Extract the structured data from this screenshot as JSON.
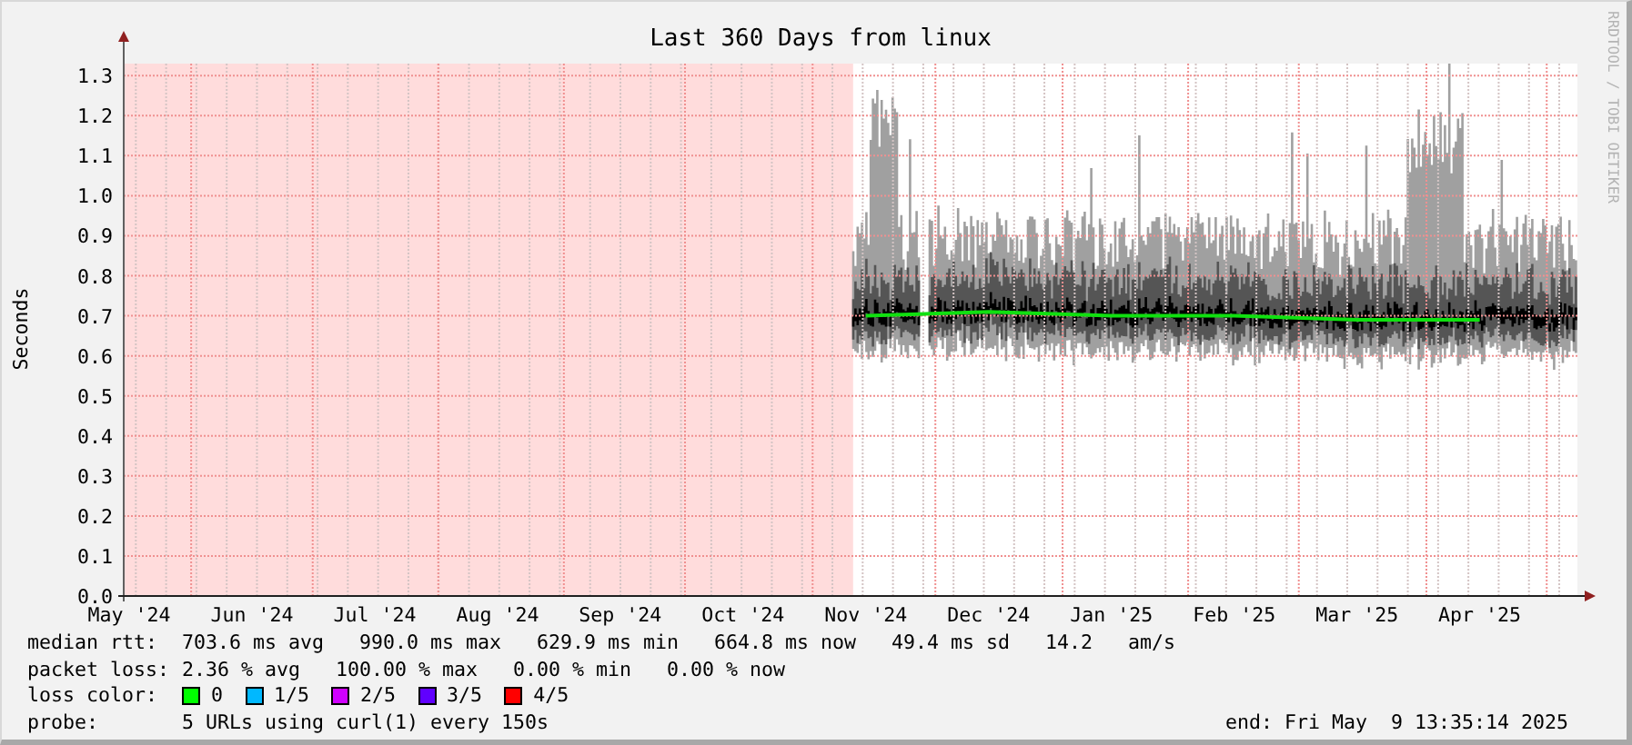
{
  "chart_data": {
    "type": "line",
    "grid": true,
    "title": "Last 360 Days from linux",
    "ylabel": "Seconds",
    "ylim": [
      0,
      1.33
    ],
    "yticks": [
      {
        "value": 0,
        "label": "0.0"
      },
      {
        "value": 0.1,
        "label": "0.1"
      },
      {
        "value": 0.2,
        "label": "0.2"
      },
      {
        "value": 0.3,
        "label": "0.3"
      },
      {
        "value": 0.4,
        "label": "0.4"
      },
      {
        "value": 0.5,
        "label": "0.5"
      },
      {
        "value": 0.6,
        "label": "0.6"
      },
      {
        "value": 0.7,
        "label": "0.7"
      },
      {
        "value": 0.8,
        "label": "0.8"
      },
      {
        "value": 0.9,
        "label": "0.9"
      },
      {
        "value": 1.0,
        "label": "1.0"
      },
      {
        "value": 1.1,
        "label": "1.1"
      },
      {
        "value": 1.2,
        "label": "1.2"
      },
      {
        "value": 1.3,
        "label": "1.3"
      }
    ],
    "categories": [
      "May '24",
      "Jun '24",
      "Jul '24",
      "Aug '24",
      "Sep '24",
      "Oct '24",
      "Nov '24",
      "Dec '24",
      "Jan '25",
      "Feb '25",
      "Mar '25",
      "Apr '25"
    ],
    "series": [
      {
        "name": "median rtt:",
        "color": "#10e010",
        "values": [
          null,
          null,
          null,
          null,
          null,
          null,
          0.7,
          0.71,
          0.7,
          0.7,
          0.69,
          0.69
        ]
      }
    ]
  },
  "credit": "RRDTOOL / TOBI OETIKER",
  "legend": {
    "median_rtt": {
      "text": "703.6 ms avg   990.0 ms max   629.9 ms min   664.8 ms now   49.4 ms sd   14.2   am/s"
    },
    "packet_loss": {
      "label": "packet loss:",
      "text": "2.36 % avg   100.00 % max   0.00 % min   0.00 % now"
    },
    "loss_color": {
      "label": "loss color:",
      "items": [
        {
          "label": "0",
          "color": "#00ff00"
        },
        {
          "label": "1/5",
          "color": "#00b8ff"
        },
        {
          "label": "2/5",
          "color": "#d000ff"
        },
        {
          "label": "3/5",
          "color": "#6000ff"
        },
        {
          "label": "4/5",
          "color": "#ff0000"
        }
      ]
    },
    "probe": {
      "label": "probe:",
      "text": "5 URLs using curl(1) every 150s"
    },
    "end": "end: Fri May  9 13:35:14 2025"
  }
}
